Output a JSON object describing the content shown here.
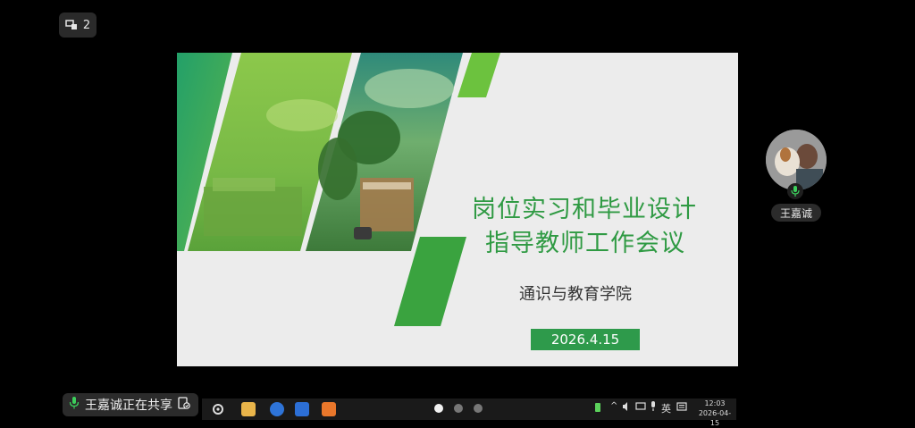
{
  "screen_counter": {
    "count": "2",
    "icon": "screen-share-icon"
  },
  "slide": {
    "title_line1": "岗位实习和毕业设计",
    "title_line2": "指导教师工作会议",
    "subtitle": "通识与教育学院",
    "date": "2026.4.15"
  },
  "presenter": {
    "name": "王嘉诚",
    "icon": "mic-icon"
  },
  "share_status": {
    "text": "王嘉诚正在共享",
    "icon": "share-screen-icon"
  },
  "pager": {
    "pages": 3,
    "current": 1
  },
  "tray": {
    "ime": "英",
    "chevron": "^"
  },
  "clock": {
    "time": "12:03",
    "date": "2026-04-15"
  },
  "colors": {
    "accent_green": "#2e9a4b",
    "title_green": "#2f9a43"
  }
}
